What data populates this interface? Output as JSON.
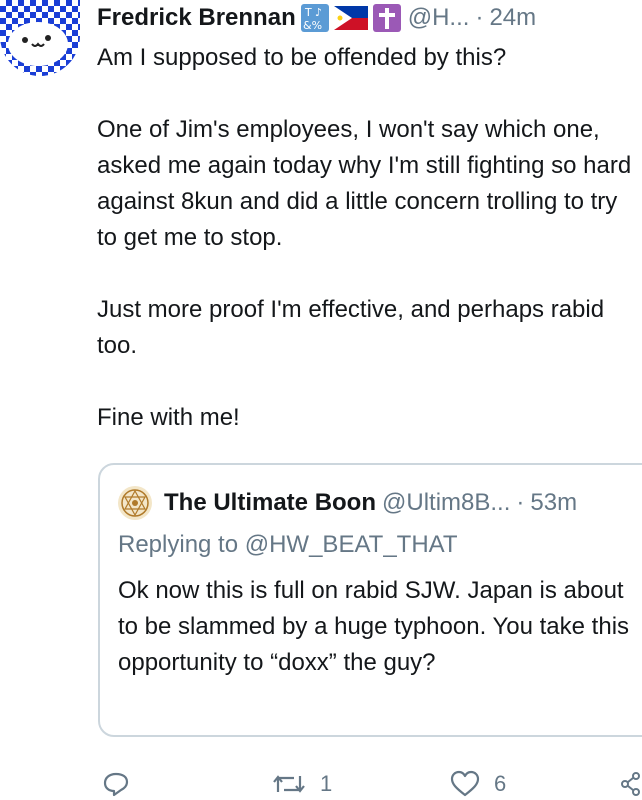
{
  "tweet": {
    "author_name": "Fredrick Brennan",
    "badges": [
      "input-symbols-icon",
      "philippines-flag-icon",
      "latin-cross-icon"
    ],
    "handle": "@H...",
    "separator": "·",
    "time": "24m",
    "paragraphs": [
      "Am I supposed to be offended by this?",
      "One of Jim's employees, I won't say which one, asked me again today why I'm still fighting so hard against 8kun and did a little concern trolling to try to get me to stop.",
      "Just more proof I'm effective, and perhaps rabid too.",
      "Fine with me!"
    ]
  },
  "quoted": {
    "author_name": "The Ultimate Boon",
    "handle": "@Ultim8B...",
    "separator": "·",
    "time": "53m",
    "replying_to": "Replying to @HW_BEAT_THAT",
    "text": "Ok now this is full on rabid SJW. Japan is about to be slammed by a huge typhoon. You take this opportunity to “doxx” the guy?"
  },
  "actions": {
    "reply_count": "",
    "retweet_count": "1",
    "like_count": "6"
  },
  "colors": {
    "text": "#14171a",
    "secondary": "#657786",
    "border": "#ccd6dd",
    "badge_blue": "#5b9bd5",
    "badge_purple": "#9b59b6"
  }
}
